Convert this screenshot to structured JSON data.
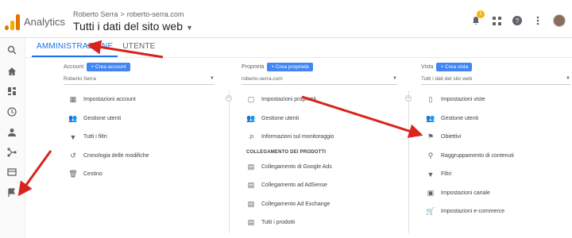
{
  "header": {
    "app_name": "Analytics",
    "account": "Roberto Serra",
    "property": "roberto-serra.com",
    "view": "Tutti i dati del sito web",
    "notification_count": "1",
    "icons": [
      "bell-icon",
      "apps-icon",
      "help-icon",
      "more-vert-icon",
      "avatar"
    ]
  },
  "sidebar": [
    "search-icon",
    "home-icon",
    "dashboard-icon",
    "clock-icon",
    "person-icon",
    "acquisition-icon",
    "display-icon",
    "flag-icon"
  ],
  "tabs": {
    "admin": "AMMINISTRAZIONE",
    "user": "UTENTE"
  },
  "columns": {
    "account": {
      "label": "Account",
      "create": "Crea account",
      "selected": "Roberto Serra",
      "items": [
        {
          "label": "Impostazioni account",
          "icon": "building-icon"
        },
        {
          "label": "Gestione utenti",
          "icon": "people-icon"
        },
        {
          "label": "Tutti i filtri",
          "icon": "filter-icon"
        },
        {
          "label": "Cronologia delle modifiche",
          "icon": "history-icon"
        },
        {
          "label": "Cestino",
          "icon": "trash-icon"
        }
      ]
    },
    "property": {
      "label": "Proprietà",
      "create": "Crea proprietà",
      "selected": "roberto-serra.com",
      "items": [
        {
          "label": "Impostazioni proprietà",
          "icon": "square-icon"
        },
        {
          "label": "Gestione utenti",
          "icon": "people-icon"
        },
        {
          "label": "Informazioni sul monitoraggio",
          "icon": "js-icon"
        }
      ],
      "section": "COLLEGAMENTO DEI PRODOTTI",
      "links": [
        {
          "label": "Collegamento di Google Ads",
          "icon": "link-icon"
        },
        {
          "label": "Collegamento ad AdSense",
          "icon": "link-icon"
        },
        {
          "label": "Collegamento Ad Exchange",
          "icon": "link-icon"
        },
        {
          "label": "Tutti i prodotti",
          "icon": "link-icon"
        }
      ]
    },
    "view": {
      "label": "Vista",
      "create": "Crea vista",
      "selected": "Tutti i dati del sito web",
      "items": [
        {
          "label": "Impostazioni viste",
          "icon": "doc-icon"
        },
        {
          "label": "Gestione utenti",
          "icon": "people-icon"
        },
        {
          "label": "Obiettivi",
          "icon": "flag-icon"
        },
        {
          "label": "Raggruppamento di contenuti",
          "icon": "hierarchy-icon"
        },
        {
          "label": "Filtri",
          "icon": "filter-icon"
        },
        {
          "label": "Impostazioni canale",
          "icon": "channel-icon"
        },
        {
          "label": "Impostazioni e-commerce",
          "icon": "cart-icon"
        }
      ]
    }
  },
  "colors": {
    "accent": "#1a73e8",
    "button": "#4285f4",
    "arrow": "#d9231d"
  }
}
